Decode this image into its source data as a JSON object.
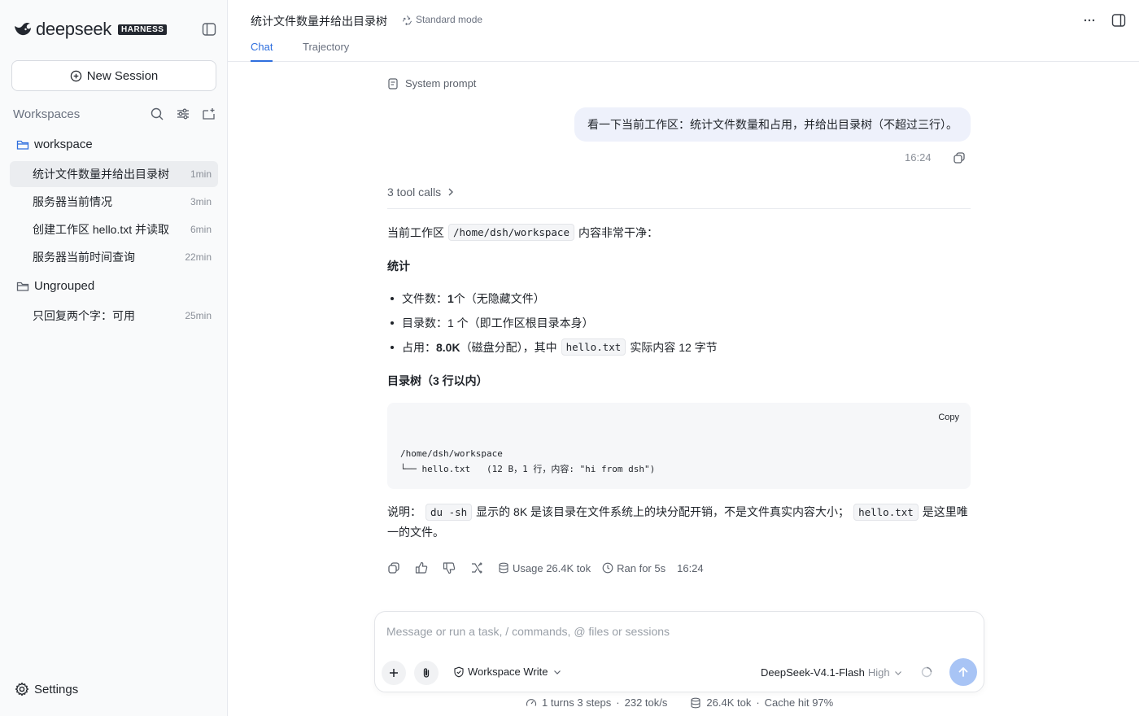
{
  "sidebar": {
    "logo_text": "deepseek",
    "logo_badge": "HARNESS",
    "new_session_label": "New Session",
    "workspaces_label": "Workspaces",
    "groups": [
      {
        "name": "workspace"
      },
      {
        "name": "Ungrouped"
      }
    ],
    "sessions": [
      {
        "title": "统计文件数量并给出目录树",
        "age": "1min"
      },
      {
        "title": "服务器当前情况",
        "age": "3min"
      },
      {
        "title": "创建工作区 hello.txt 并读取",
        "age": "6min"
      },
      {
        "title": "服务器当前时间查询",
        "age": "22min"
      },
      {
        "title": "只回复两个字：可用",
        "age": "25min"
      }
    ],
    "settings_label": "Settings"
  },
  "header": {
    "title": "统计文件数量并给出目录树",
    "mode": "Standard mode",
    "tabs": [
      {
        "label": "Chat"
      },
      {
        "label": "Trajectory"
      }
    ]
  },
  "chat": {
    "system_prompt_label": "System prompt",
    "user_message": "看一下当前工作区：统计文件数量和占用，并给出目录树（不超过三行）。",
    "user_time": "16:24",
    "tool_calls_label": "3 tool calls",
    "intro_before": "当前工作区",
    "intro_code": "/home/dsh/workspace",
    "intro_after": "内容非常干净：",
    "stats_heading": "统计",
    "bullets": [
      {
        "pre": "文件数：",
        "bold": "1",
        "post": " 个（无隐藏文件）"
      },
      {
        "pre": "目录数：1 个（即工作区根目录本身）"
      },
      {
        "pre": "占用：",
        "bold": "8.0K",
        "post": "（磁盘分配），其中",
        "code": "hello.txt",
        "post2": "实际内容 12 字节"
      }
    ],
    "tree_heading": "目录树（3 行以内）",
    "code_copy_label": "Copy",
    "code_lines": [
      "/home/dsh/workspace",
      "└── hello.txt   (12 B，1 行，内容: \"hi from dsh\")"
    ],
    "note": {
      "prefix": "说明：",
      "code1": "du -sh",
      "middle": "显示的 8K 是该目录在文件系统上的块分配开销，不是文件真实内容大小；",
      "code2": "hello.txt",
      "suffix": "是这里唯一的文件。"
    },
    "actions": {
      "usage": "Usage 26.4K tok",
      "ran": "Ran for 5s",
      "time": "16:24"
    }
  },
  "composer": {
    "placeholder": "Message or run a task, / commands, @ files or sessions",
    "permission": "Workspace Write",
    "model": "DeepSeek-V4.1-Flash",
    "effort": "High"
  },
  "footer": {
    "turns": "1 turns 3 steps",
    "speed": "232 tok/s",
    "tokens": "26.4K tok",
    "cache": "Cache hit 97%"
  }
}
